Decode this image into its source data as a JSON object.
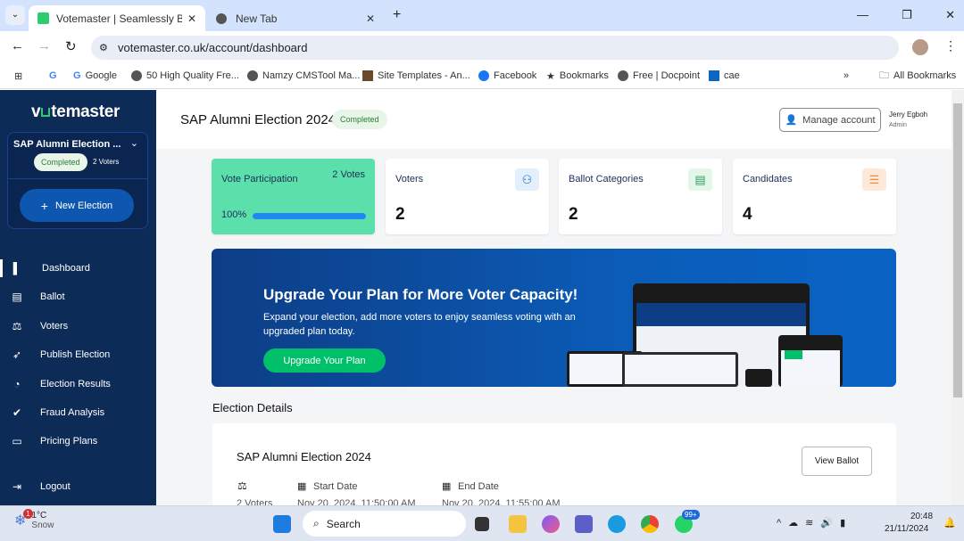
{
  "browser": {
    "tabs": [
      {
        "title": "Votemaster | Seamlessly Build a",
        "active": true
      },
      {
        "title": "New Tab",
        "active": false
      }
    ],
    "url": "votemaster.co.uk/account/dashboard",
    "bookmarks": [
      "Google",
      "50 High Quality Fre...",
      "Namzy CMSTool Ma...",
      "Site Templates - An...",
      "Facebook",
      "Bookmarks",
      "Free | Docpoint",
      "cae"
    ],
    "all_bookmarks": "All Bookmarks"
  },
  "sidebar": {
    "logo": "votemaster",
    "election": {
      "name": "SAP Alumni Election ...",
      "status": "Completed",
      "voters": "2 Voters"
    },
    "new_election": "New Election",
    "items": [
      {
        "label": "Dashboard",
        "icon": "dashboard-icon"
      },
      {
        "label": "Ballot",
        "icon": "ballot-icon"
      },
      {
        "label": "Voters",
        "icon": "voters-icon"
      },
      {
        "label": "Publish Election",
        "icon": "rocket-icon"
      },
      {
        "label": "Election Results",
        "icon": "chart-pie-icon"
      },
      {
        "label": "Fraud Analysis",
        "icon": "check-circle-icon"
      },
      {
        "label": "Pricing Plans",
        "icon": "credit-card-icon"
      }
    ],
    "logout": "Logout"
  },
  "header": {
    "title": "SAP Alumni Election 2024",
    "status": "Completed",
    "manage": "Manage account",
    "user": "Jerry Egboh",
    "role": "Admin"
  },
  "stats": {
    "participation": {
      "label": "Vote Participation",
      "votes": "2 Votes",
      "percent": "100%",
      "value": 100
    },
    "cards": [
      {
        "label": "Voters",
        "value": "2"
      },
      {
        "label": "Ballot Categories",
        "value": "2"
      },
      {
        "label": "Candidates",
        "value": "4"
      }
    ]
  },
  "banner": {
    "title": "Upgrade Your Plan for More Voter Capacity!",
    "text": "Expand your election, add more voters to enjoy seamless voting with an upgraded plan today.",
    "button": "Upgrade Your Plan"
  },
  "details": {
    "heading": "Election Details",
    "name": "SAP Alumni Election 2024",
    "view_ballot": "View Ballot",
    "voters": "2 Voters",
    "start_label": "Start Date",
    "start": "Nov 20, 2024, 11:50:00 AM",
    "end_label": "End Date",
    "end": "Nov 20, 2024, 11:55:00 AM"
  },
  "taskbar": {
    "weather_temp": "1°C",
    "weather_desc": "Snow",
    "weather_badge": "1",
    "search": "Search",
    "whatsapp_badge": "99+",
    "time": "20:48",
    "date": "21/11/2024"
  },
  "colors": {
    "sidebar": "#0c2b57",
    "accent": "#1565c0",
    "participation": "#5ce0ab",
    "progress": "#1e88f5",
    "success": "#00c16a"
  }
}
